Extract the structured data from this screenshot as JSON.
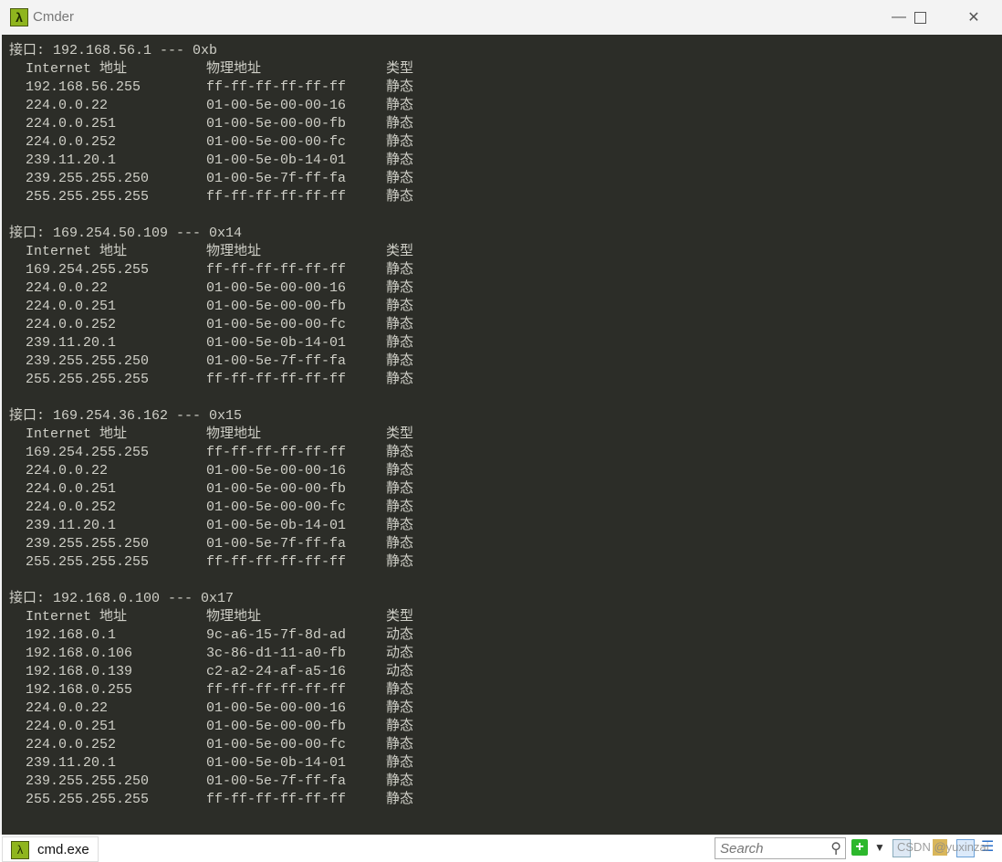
{
  "window": {
    "title": "Cmder",
    "app_icon": "lambda-icon",
    "controls": [
      "minimize-icon",
      "maximize-icon",
      "close-icon"
    ]
  },
  "terminal": {
    "column_headers": [
      "Internet 地址",
      "物理地址",
      "类型"
    ],
    "interfaces": [
      {
        "header": "接口: 192.168.56.1 --- 0xb",
        "rows": [
          [
            "192.168.56.255",
            "ff-ff-ff-ff-ff-ff",
            "静态"
          ],
          [
            "224.0.0.22",
            "01-00-5e-00-00-16",
            "静态"
          ],
          [
            "224.0.0.251",
            "01-00-5e-00-00-fb",
            "静态"
          ],
          [
            "224.0.0.252",
            "01-00-5e-00-00-fc",
            "静态"
          ],
          [
            "239.11.20.1",
            "01-00-5e-0b-14-01",
            "静态"
          ],
          [
            "239.255.255.250",
            "01-00-5e-7f-ff-fa",
            "静态"
          ],
          [
            "255.255.255.255",
            "ff-ff-ff-ff-ff-ff",
            "静态"
          ]
        ]
      },
      {
        "header": "接口: 169.254.50.109 --- 0x14",
        "rows": [
          [
            "169.254.255.255",
            "ff-ff-ff-ff-ff-ff",
            "静态"
          ],
          [
            "224.0.0.22",
            "01-00-5e-00-00-16",
            "静态"
          ],
          [
            "224.0.0.251",
            "01-00-5e-00-00-fb",
            "静态"
          ],
          [
            "224.0.0.252",
            "01-00-5e-00-00-fc",
            "静态"
          ],
          [
            "239.11.20.1",
            "01-00-5e-0b-14-01",
            "静态"
          ],
          [
            "239.255.255.250",
            "01-00-5e-7f-ff-fa",
            "静态"
          ],
          [
            "255.255.255.255",
            "ff-ff-ff-ff-ff-ff",
            "静态"
          ]
        ]
      },
      {
        "header": "接口: 169.254.36.162 --- 0x15",
        "rows": [
          [
            "169.254.255.255",
            "ff-ff-ff-ff-ff-ff",
            "静态"
          ],
          [
            "224.0.0.22",
            "01-00-5e-00-00-16",
            "静态"
          ],
          [
            "224.0.0.251",
            "01-00-5e-00-00-fb",
            "静态"
          ],
          [
            "224.0.0.252",
            "01-00-5e-00-00-fc",
            "静态"
          ],
          [
            "239.11.20.1",
            "01-00-5e-0b-14-01",
            "静态"
          ],
          [
            "239.255.255.250",
            "01-00-5e-7f-ff-fa",
            "静态"
          ],
          [
            "255.255.255.255",
            "ff-ff-ff-ff-ff-ff",
            "静态"
          ]
        ]
      },
      {
        "header": "接口: 192.168.0.100 --- 0x17",
        "rows": [
          [
            "192.168.0.1",
            "9c-a6-15-7f-8d-ad",
            "动态"
          ],
          [
            "192.168.0.106",
            "3c-86-d1-11-a0-fb",
            "动态"
          ],
          [
            "192.168.0.139",
            "c2-a2-24-af-a5-16",
            "动态"
          ],
          [
            "192.168.0.255",
            "ff-ff-ff-ff-ff-ff",
            "静态"
          ],
          [
            "224.0.0.22",
            "01-00-5e-00-00-16",
            "静态"
          ],
          [
            "224.0.0.251",
            "01-00-5e-00-00-fb",
            "静态"
          ],
          [
            "224.0.0.252",
            "01-00-5e-00-00-fc",
            "静态"
          ],
          [
            "239.11.20.1",
            "01-00-5e-0b-14-01",
            "静态"
          ],
          [
            "239.255.255.250",
            "01-00-5e-7f-ff-fa",
            "静态"
          ],
          [
            "255.255.255.255",
            "ff-ff-ff-ff-ff-ff",
            "静态"
          ]
        ]
      }
    ]
  },
  "statusbar": {
    "tab_label": "cmd.exe",
    "search_placeholder": "Search",
    "watermark": "CSDN @yuxinzai"
  },
  "colors": {
    "terminal_bg": "#2c2d28",
    "terminal_fg": "#cfcfc7",
    "accent": "#8fb51e"
  }
}
